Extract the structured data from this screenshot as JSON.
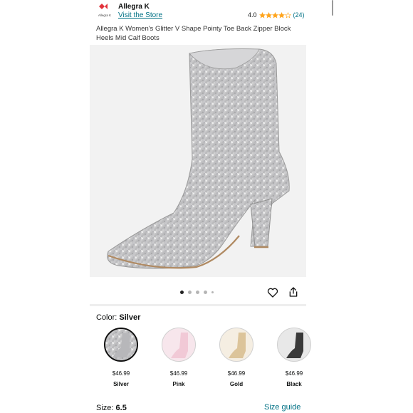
{
  "brand": {
    "name": "Allegra K",
    "logo_text": "Allegra K",
    "visit_store": "Visit the Store"
  },
  "rating": {
    "value": "4.0",
    "stars": 4,
    "count": "(24)",
    "star_color": "#ffa41c"
  },
  "product": {
    "title": "Allegra K Women's Glitter V Shape Pointy Toe Back Zipper Block Heels Mid Calf Boots"
  },
  "gallery": {
    "image_count": 5,
    "active_index": 0
  },
  "icons": {
    "favorite": "heart-icon",
    "share": "share-icon"
  },
  "color_selector": {
    "label": "Color:",
    "selected": "Silver",
    "options": [
      {
        "name": "Silver",
        "price": "$46.99",
        "color": "#c8c8c8"
      },
      {
        "name": "Pink",
        "price": "$46.99",
        "color": "#f1c9d6"
      },
      {
        "name": "Gold",
        "price": "$46.99",
        "color": "#dcc49a"
      },
      {
        "name": "Black",
        "price": "$46.99",
        "color": "#3a3a3a"
      }
    ]
  },
  "size_selector": {
    "label": "Size:",
    "selected": "6.5",
    "guide": "Size guide"
  },
  "colors": {
    "link": "#007185",
    "text": "#0f1111"
  }
}
